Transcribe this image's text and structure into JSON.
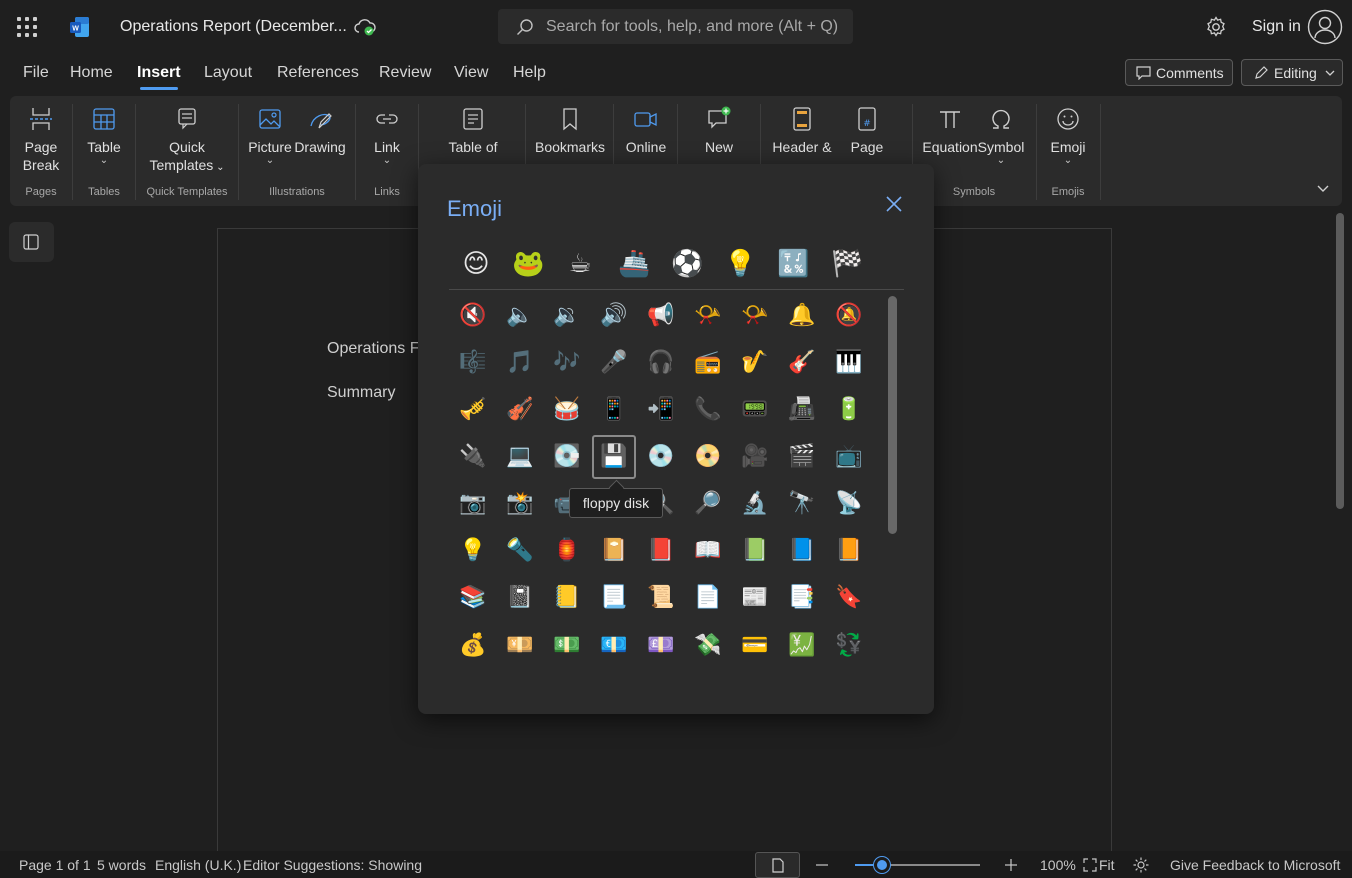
{
  "app": {
    "doc_title": "Operations Report (December...",
    "search_placeholder": "Search for tools, help, and more (Alt + Q)",
    "sign_in": "Sign in"
  },
  "menu": {
    "items": [
      "File",
      "Home",
      "Insert",
      "Layout",
      "References",
      "Review",
      "View",
      "Help"
    ],
    "active": "Insert",
    "comments": "Comments",
    "editing": "Editing"
  },
  "ribbon": {
    "page_break": "Page Break",
    "page_break_line1": "Page",
    "page_break_line2": "Break",
    "pages_group": "Pages",
    "table": "Table",
    "tables_group": "Tables",
    "quick_templates_line1": "Quick",
    "quick_templates_line2": "Templates",
    "quick_templates_group": "Quick Templates",
    "picture": "Picture",
    "drawing": "Drawing",
    "illustrations_group": "Illustrations",
    "link": "Link",
    "links_group": "Links",
    "table_of": "Table of",
    "bookmarks": "Bookmarks",
    "online": "Online",
    "new": "New",
    "header": "Header &",
    "page": "Page",
    "equation": "Equation",
    "symbol": "Symbol",
    "symbols_group": "Symbols",
    "emoji": "Emoji",
    "emojis_group": "Emojis"
  },
  "document": {
    "heading_partial": "Operations F",
    "summary": "Summary"
  },
  "emoji_panel": {
    "title": "Emoji",
    "categories": [
      "😊",
      "🐸",
      "☕",
      "🚢",
      "⚽",
      "💡",
      "🔣",
      "🏁"
    ],
    "rows": [
      [
        "🔇",
        "🔈",
        "🔉",
        "🔊",
        "📢",
        "📯",
        "📯",
        "🔔",
        "🔕"
      ],
      [
        "🎼",
        "🎵",
        "🎶",
        "🎤",
        "🎧",
        "📻",
        "🎷",
        "🎸",
        "🎹"
      ],
      [
        "🎺",
        "🎻",
        "🥁",
        "📱",
        "📲",
        "📞",
        "📟",
        "📠",
        "🔋"
      ],
      [
        "🔌",
        "💻",
        "💽",
        "💾",
        "💿",
        "📀",
        "🎥",
        "🎬",
        "📺"
      ],
      [
        "📷",
        "📸",
        "📹",
        "📼",
        "🔍",
        "🔎",
        "🔬",
        "🔭",
        "📡"
      ],
      [
        "💡",
        "🔦",
        "🏮",
        "📔",
        "📕",
        "📖",
        "📗",
        "📘",
        "📙"
      ],
      [
        "📚",
        "📓",
        "📒",
        "📃",
        "📜",
        "📄",
        "📰",
        "📑",
        "🔖"
      ],
      [
        "💰",
        "💴",
        "💵",
        "💶",
        "💷",
        "💸",
        "💳",
        "💹",
        "💱"
      ]
    ],
    "tooltip": "floppy disk"
  },
  "status": {
    "page": "Page 1 of 1",
    "words": "5 words",
    "language": "English (U.K.)",
    "suggestions": "Editor Suggestions: Showing",
    "zoom": "100%",
    "fit": "Fit",
    "feedback": "Give Feedback to Microsoft",
    "zoom_fraction": 0.22
  },
  "colors": {
    "accent": "#4f9bf0",
    "emoji_title": "#7aaef5",
    "background": "#1f1f1f",
    "ribbon": "#2b2b2b"
  }
}
